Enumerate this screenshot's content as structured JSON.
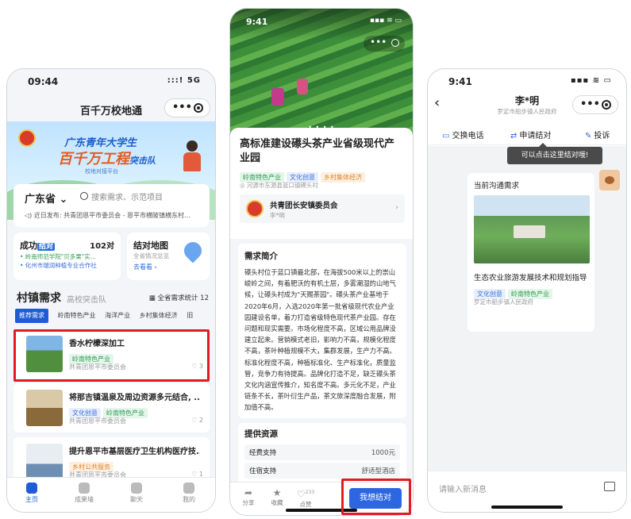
{
  "colors": {
    "primary": "#1f5bd6",
    "highlight": "#e11b22",
    "tag_blue": "#3a6fd8",
    "tag_green": "#2f9c55",
    "tag_orange": "#e0862a"
  },
  "phone1": {
    "time": "09:44",
    "signal": ":::! 5G",
    "nav_title": "百千万校地通",
    "banner": {
      "line1": "广东青年大学生",
      "line2": "百千万工程",
      "line2b": "突击队",
      "line3": "校地对接平台"
    },
    "province": "广东省",
    "search_placeholder": "搜索需求、示范项目",
    "announcement": "近日发布: 共青团恩平市委员会 - 恩平市横陂镇横东村...",
    "card_success": {
      "title": "成功",
      "badge": "结对",
      "count": "102对",
      "line1": "• 岭南师范学院\"贝多果\"实...",
      "line2": "• 化州市瑞润种植专业合作社"
    },
    "card_map": {
      "title": "结对地图",
      "sub": "全省情况总览",
      "link": "去看看 ›"
    },
    "section_title": "村镇需求",
    "section_alt": "高校突击队",
    "stat_link": "全省需求统计 12",
    "tabs": [
      "推荐需求",
      "岭南特色产业",
      "海洋产业",
      "乡村集体经济",
      "旧"
    ],
    "items": [
      {
        "title": "香水柠檬深加工",
        "tags": [
          "岭南特色产业"
        ],
        "org": "共青团恩平市委员会",
        "likes": "3"
      },
      {
        "title": "将那吉镇温泉及周边资源多元结合, ...",
        "tags": [
          "文化创意",
          "岭南特色产业"
        ],
        "org": "共青团恩平市委员会",
        "likes": "2"
      },
      {
        "title": "提升恩平市基层医疗卫生机构医疗技...",
        "tags": [
          "乡村公共服务"
        ],
        "org": "共青团恩平市委员会",
        "likes": "1"
      }
    ],
    "tabbar": [
      "主页",
      "成果墙",
      "聊天",
      "我的"
    ]
  },
  "phone2": {
    "time": "9:41",
    "pager": "• • • •",
    "title": "高标准建设礤头茶产业省级现代产业园",
    "tags": [
      "岭南特色产业",
      "文化创意",
      "乡村集体经济"
    ],
    "address": "◎ 河源市东源县蓝口镇礤头村",
    "publisher": "共青团长安镇委员会",
    "publisher_sub": "李*明",
    "desc_heading": "需求简介",
    "desc_body": "礤头村位于蓝口镇最北部，在海拔500米以上的崇山峻岭之间，有着肥沃的有机土层，多雾潮湿的山地气候，让礤头村成为\"天赐茶园\"。礤头茶产业基地于2020年6月，入选2020年第一批省级现代农业产业园建设名单，着力打造省级特色现代茶产业园。存在问题和现实需要。市场化程度不高，区域公用品牌没建立起来。营销模式老旧，影响力不高，规模化程度不高，茶叶种植规模不大，集群发展，生产力不高。标准化程度不高，种植标准化、生产标准化，质量监管，竞争力有待提高。品牌化打造不足，缺乏礤头茶文化内涵宣传推介，知名度不高。多元化不足，产业链条不长，茶叶衍生产品，茶文旅深度融合发展，附加值不高。",
    "resource_heading": "提供资源",
    "resources": [
      {
        "k": "经费支持",
        "v": "1000元"
      },
      {
        "k": "住宿支持",
        "v": "舒适型酒店"
      }
    ],
    "bottom": {
      "share": "分享",
      "collect": "收藏",
      "like": "点赞",
      "like_count": "233",
      "want": "我想结对"
    }
  },
  "phone3": {
    "time": "9:41",
    "name": "李*明",
    "sub": "罗定市船步镇人民政府",
    "actions": [
      "交换电话",
      "申请结对",
      "投诉"
    ],
    "tooltip": "可以点击这里结对哦!",
    "msg_heading": "当前沟通需求",
    "msg_title": "生态农业旅游发展技术和规划指导",
    "msg_tags": [
      "文化创意",
      "岭南特色产业"
    ],
    "msg_org": "罗定市船步镇人民政府",
    "input_placeholder": "请输入新消息"
  }
}
